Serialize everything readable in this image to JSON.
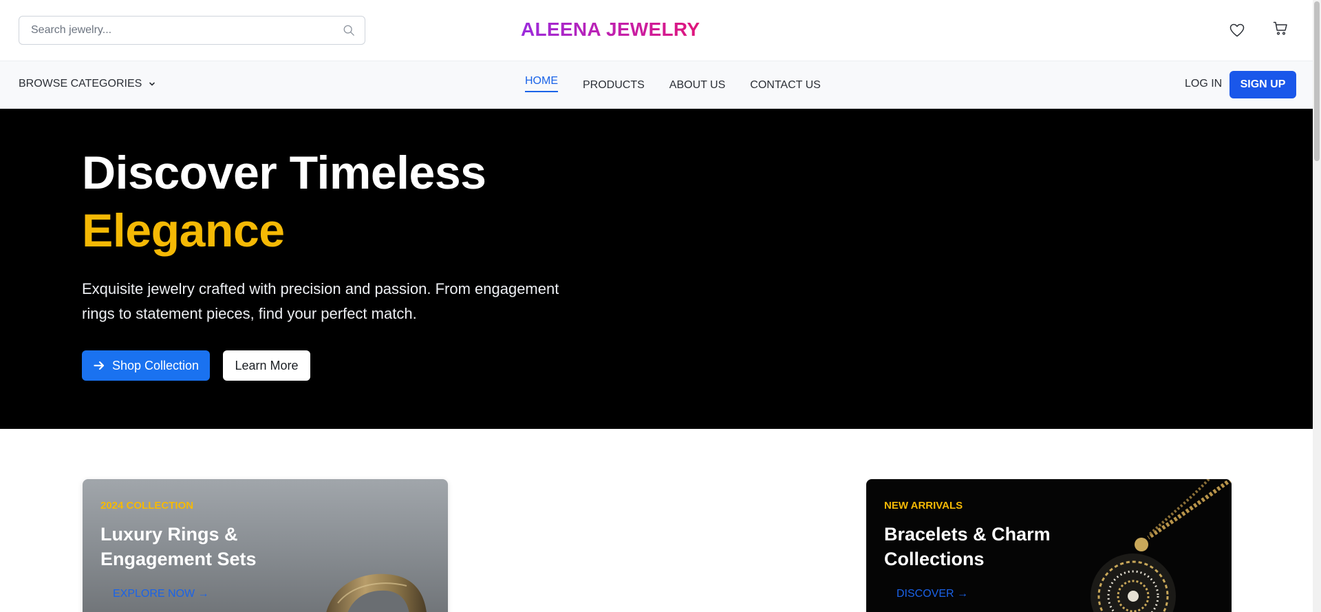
{
  "header": {
    "search": {
      "placeholder": "Search jewelry...",
      "value": ""
    },
    "brand": "ALEENA JEWELRY",
    "icons": {
      "wishlist": "heart-icon",
      "cart": "cart-icon",
      "search": "search-icon"
    }
  },
  "nav": {
    "browse_label": "BROWSE CATEGORIES",
    "links": [
      {
        "label": "HOME",
        "active": true
      },
      {
        "label": "PRODUCTS",
        "active": false
      },
      {
        "label": "ABOUT US",
        "active": false
      },
      {
        "label": "CONTACT US",
        "active": false
      }
    ],
    "login_label": "LOG IN",
    "signup_label": "SIGN UP"
  },
  "hero": {
    "title_line1": "Discover Timeless",
    "title_line2": "Elegance",
    "description": "Exquisite jewelry crafted with precision and passion. From engagement rings to statement pieces, find your perfect match.",
    "primary_button": "Shop Collection",
    "secondary_button": "Learn More"
  },
  "cards": [
    {
      "eyebrow": "2024 COLLECTION",
      "title": "Luxury Rings & Engagement Sets",
      "link": "EXPLORE NOW →"
    },
    {
      "eyebrow": "NEW ARRIVALS",
      "title": "Bracelets & Charm Collections",
      "link": "DISCOVER →"
    }
  ],
  "colors": {
    "accent_blue": "#1a57ea",
    "gold": "#f5b905",
    "brand_gradient_start": "#9b2bdc",
    "brand_gradient_end": "#e0157a"
  }
}
